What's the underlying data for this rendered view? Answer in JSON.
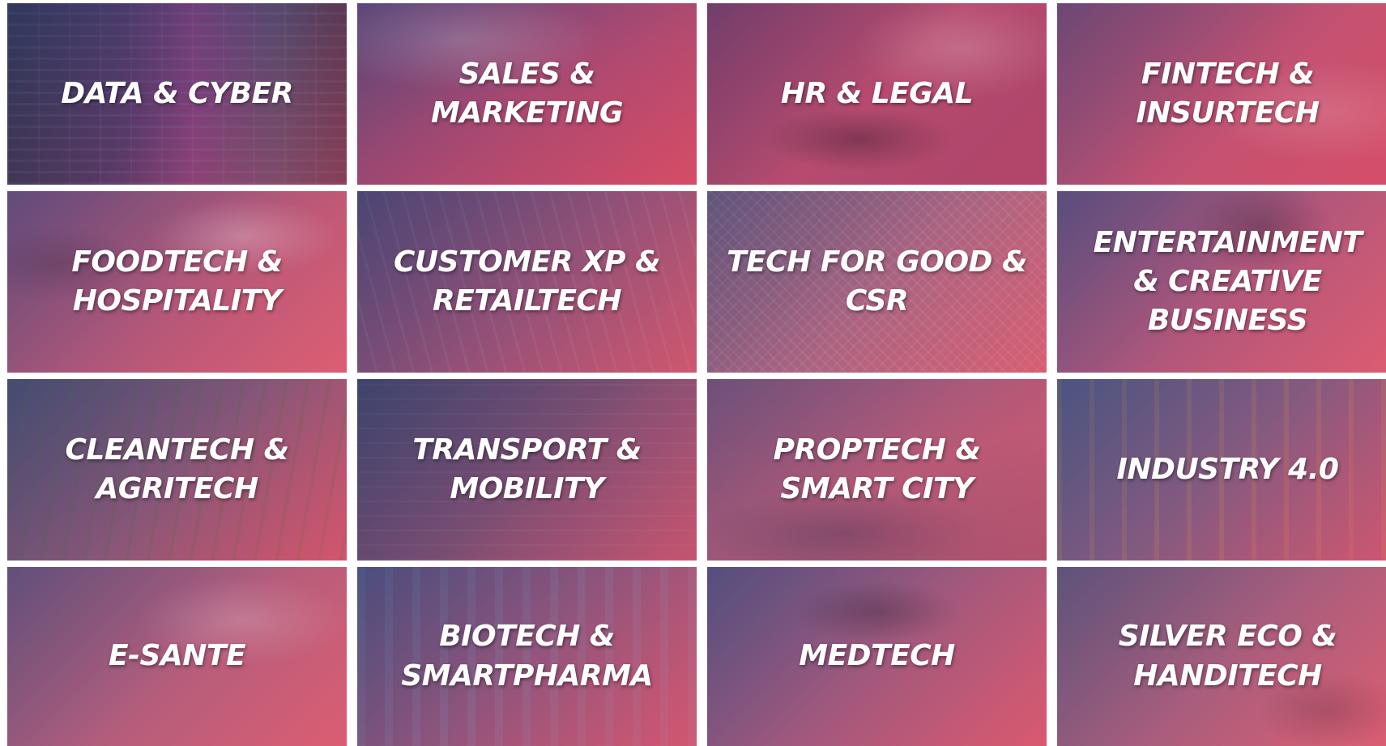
{
  "tiles": [
    {
      "label": "DATA & CYBER"
    },
    {
      "label": "SALES &\nMARKETING"
    },
    {
      "label": "HR & LEGAL"
    },
    {
      "label": "FINTECH &\nINSURTECH"
    },
    {
      "label": "FOODTECH &\nHOSPITALITY"
    },
    {
      "label": "CUSTOMER XP  &\nRETAILTECH"
    },
    {
      "label": "TECH FOR GOOD &\nCSR"
    },
    {
      "label": "ENTERTAINMENT\n& CREATIVE\nBUSINESS"
    },
    {
      "label": "CLEANTECH &\nAGRITECH"
    },
    {
      "label": "TRANSPORT &\nMOBILITY"
    },
    {
      "label": "PROPTECH &\nSMART CITY"
    },
    {
      "label": "INDUSTRY 4.0"
    },
    {
      "label": "E-SANTE"
    },
    {
      "label": "BIOTECH &\nSMARTPHARMA"
    },
    {
      "label": "MEDTECH"
    },
    {
      "label": "SILVER ECO &\nHANDITECH"
    }
  ]
}
